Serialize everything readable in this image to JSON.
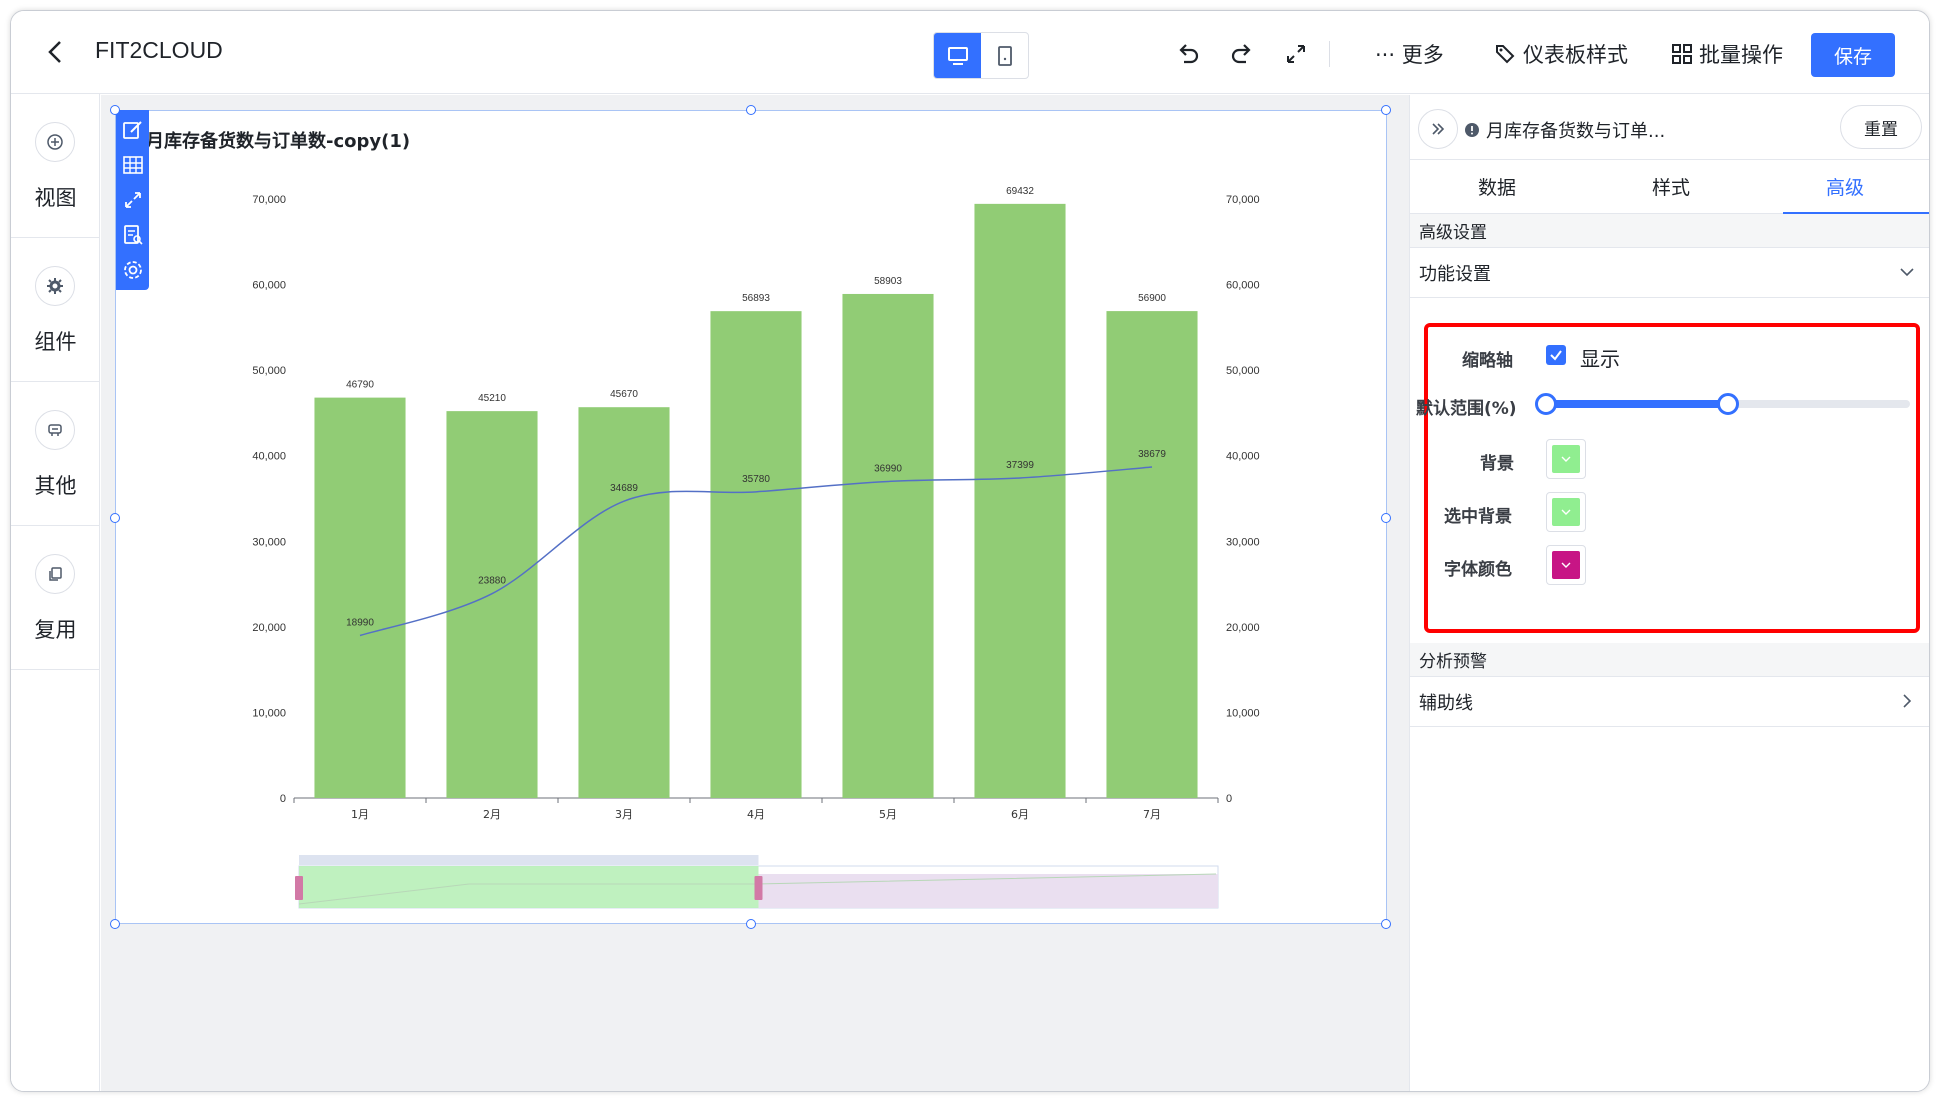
{
  "header": {
    "title": "FIT2CLOUD",
    "more_label": "··· 更多",
    "dashboard_style_label": "仪表板样式",
    "batch_label": "批量操作",
    "save_label": "保存",
    "icons": [
      "back-icon",
      "desktop-icon",
      "mobile-icon",
      "undo-icon",
      "redo-icon",
      "fullscreen-icon",
      "more-icon",
      "dashboard-style-icon",
      "batch-icon"
    ]
  },
  "sidebar": {
    "items": [
      {
        "label": "视图",
        "icon": "add-circle-icon"
      },
      {
        "label": "组件",
        "icon": "gear-icon"
      },
      {
        "label": "其他",
        "icon": "other-icon"
      },
      {
        "label": "复用",
        "icon": "copy-icon"
      }
    ]
  },
  "canvas": {
    "chart_title": "月库存备货数与订单数-copy(1)",
    "toolbar_icons": [
      "edit-icon",
      "grid-icon",
      "expand-icon",
      "detail-icon",
      "settings-icon"
    ]
  },
  "chart_data": {
    "type": "bar",
    "categories": [
      "1月",
      "2月",
      "3月",
      "4月",
      "5月",
      "6月",
      "7月"
    ],
    "series": [
      {
        "type": "bar",
        "values": [
          46790,
          45210,
          45670,
          56893,
          58903,
          69432,
          56900
        ],
        "color": "#91cc75",
        "axis": "left"
      },
      {
        "type": "line",
        "values": [
          18990,
          23880,
          34689,
          35780,
          36990,
          37399,
          38679
        ],
        "color": "#5470c6",
        "axis": "right"
      }
    ],
    "ylim": [
      0,
      70000
    ],
    "y_ticks": [
      "70,000",
      "60,000",
      "50,000",
      "40,000",
      "30,000",
      "20,000",
      "10,000",
      "0"
    ],
    "y2_ticks": [
      "70,000",
      "60,000",
      "50,000",
      "40,000",
      "30,000",
      "20,000",
      "10,000",
      "0"
    ],
    "data_labels": true,
    "grid": false,
    "zoom_range_percent": [
      0,
      50
    ],
    "zoom_fill_color": "#b8f0b8",
    "zoom_unselected_color": "#eadff0",
    "zoom_handle_color": "#d279a6"
  },
  "panel": {
    "title": "月库存备货数与订单...",
    "reset_label": "重置",
    "tabs": [
      {
        "label": "数据",
        "active": false
      },
      {
        "label": "样式",
        "active": false
      },
      {
        "label": "高级",
        "active": true
      }
    ],
    "advanced_heading": "高级设置",
    "function_settings_label": "功能设置",
    "thumbnail_axis_label": "缩略轴",
    "show_label": "显示",
    "show_checked": true,
    "default_range_label": "默认范围(%)",
    "default_range": [
      0,
      50
    ],
    "background_label": "背景",
    "background_color": "#90ee90",
    "selected_bg_label": "选中背景",
    "selected_bg_color": "#90ee90",
    "font_color_label": "字体颜色",
    "font_color": "#c71585",
    "analysis_heading": "分析预警",
    "aux_line_label": "辅助线"
  },
  "colors": {
    "accent": "#3370ff",
    "highlight": "#ff0000"
  }
}
